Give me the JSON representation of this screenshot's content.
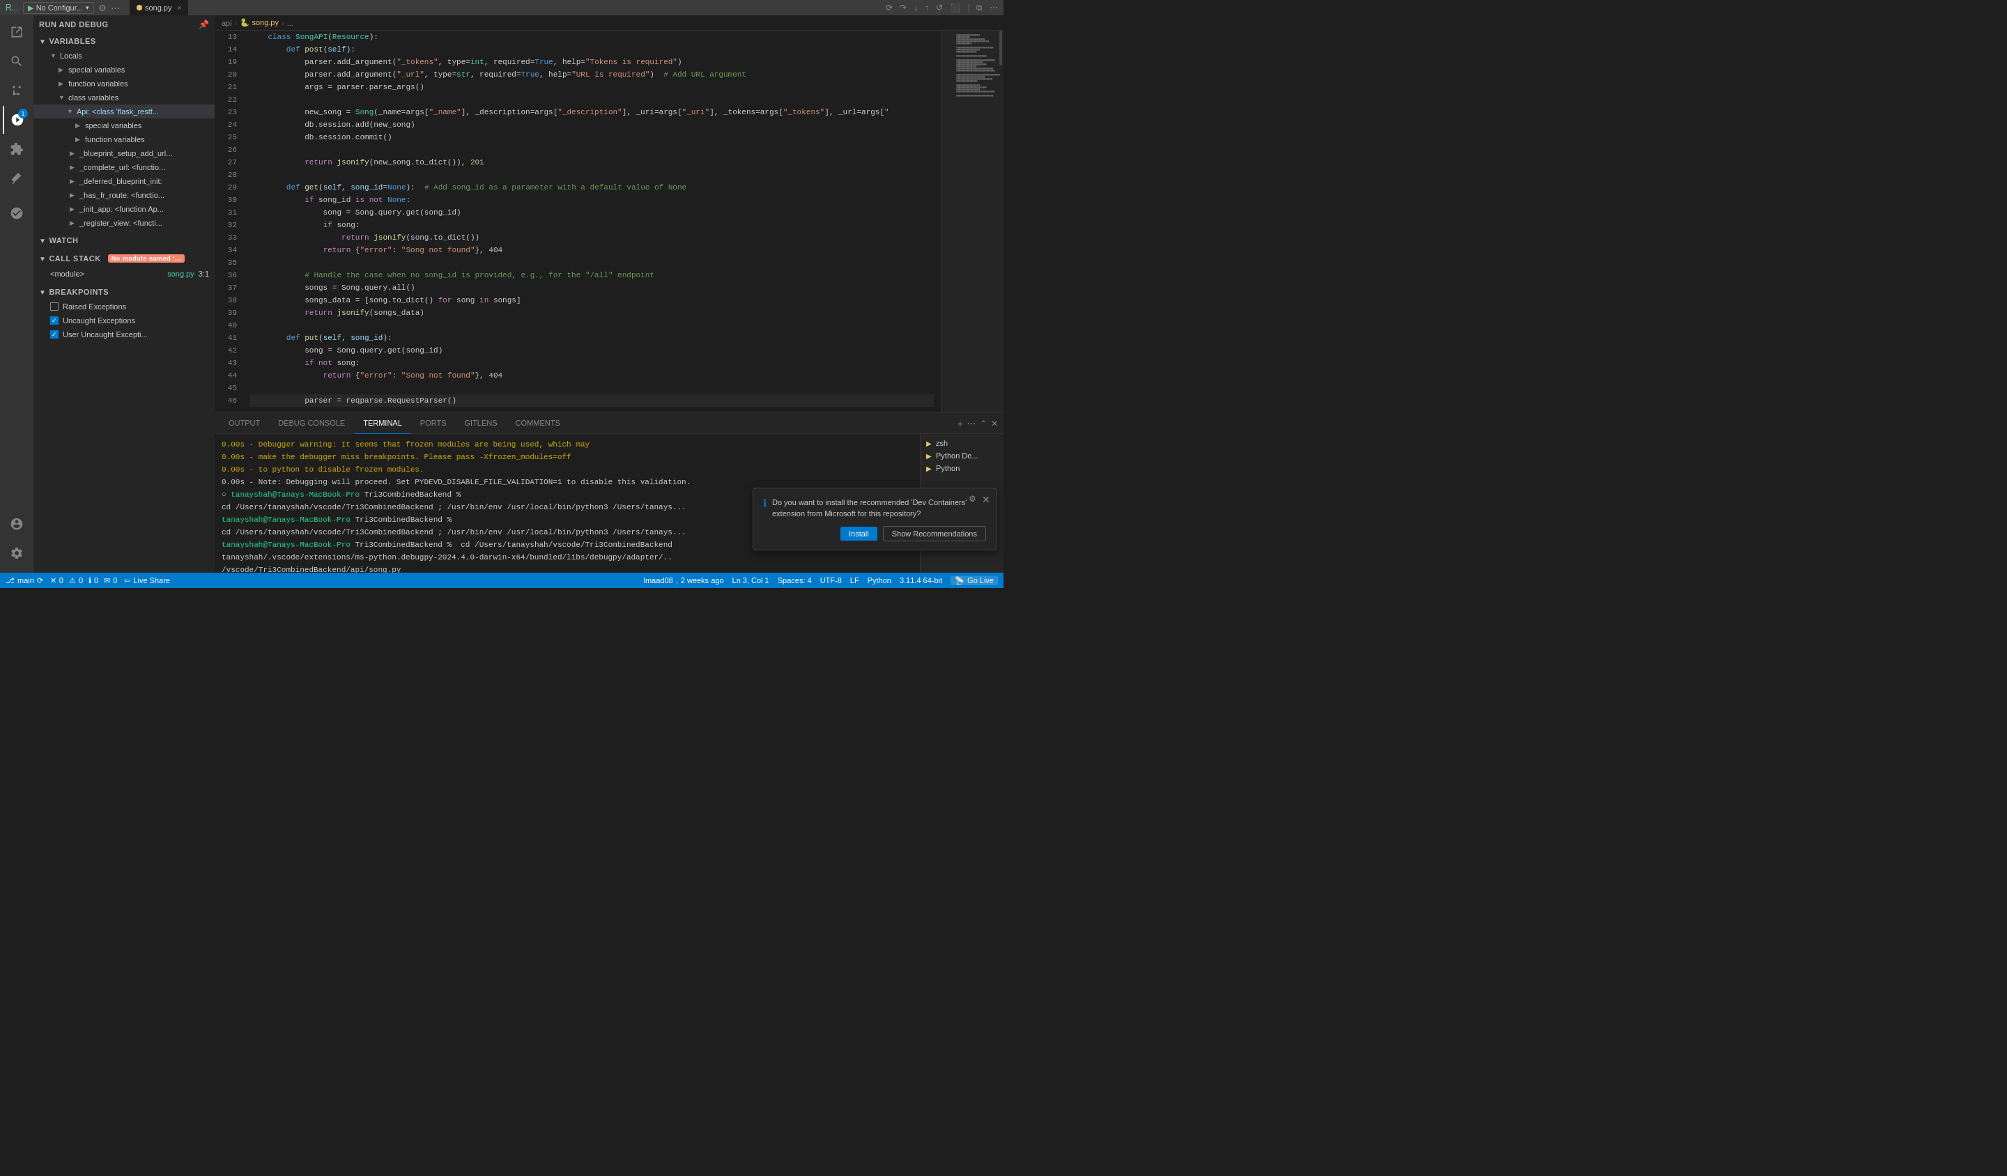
{
  "titlebar": {
    "tab_label": "song.py",
    "tab_close": "×",
    "run_config": "No Configur...",
    "more_icon": "⋯"
  },
  "breadcrumb": {
    "parts": [
      "api",
      ">",
      "song.py",
      ">",
      "..."
    ]
  },
  "sidebar": {
    "title": "RUN AND DEBUG",
    "variables_label": "VARIABLES",
    "locals_label": "Locals",
    "special_vars_label": "special variables",
    "function_vars_label": "function variables",
    "class_vars_label": "class variables",
    "api_class_label": "Api: <class 'flask_restf...",
    "api_special_vars": "special variables",
    "api_function_vars": "function variables",
    "blueprint_label": "_blueprint_setup_add_url...",
    "complete_url_label": "_complete_url: <functio...",
    "deferred_blueprint_label": "_deferred_blueprint_init:",
    "has_fr_route_label": "_has_fr_route: <functio...",
    "init_app_label": "_init_app: <function Ap...",
    "register_view_label": "_register_view: <functi...",
    "watch_label": "WATCH",
    "callstack_label": "CALL STACK",
    "callstack_badge": "No module named '...",
    "module_label": "<module>",
    "file_label": "song.py",
    "file_line": "3:1",
    "breakpoints_label": "BREAKPOINTS",
    "raised_exceptions_label": "Raised Exceptions",
    "uncaught_exceptions_label": "Uncaught Exceptions",
    "user_uncaught_label": "User Uncaught Excepti..."
  },
  "code": {
    "lines": [
      {
        "num": 13,
        "content": "    class SongAPI(Resource):"
      },
      {
        "num": 14,
        "content": "        def post(self):"
      },
      {
        "num": 19,
        "content": "            parser.add_argument(\"_tokens\", type=int, required=True, help=\"Tokens is required\")"
      },
      {
        "num": 20,
        "content": "            parser.add_argument(\"_url\", type=str, required=True, help=\"URL is required\")  # Add URL argument"
      },
      {
        "num": 21,
        "content": "            args = parser.parse_args()"
      },
      {
        "num": 22,
        "content": ""
      },
      {
        "num": 23,
        "content": "            new_song = Song(_name=args[\"_name\"], _description=args[\"_description\"], _uri=args[\"_uri\"], _tokens=args[\"_tokens\"], _url=args[\""
      },
      {
        "num": 24,
        "content": "            db.session.add(new_song)"
      },
      {
        "num": 25,
        "content": "            db.session.commit()"
      },
      {
        "num": 26,
        "content": ""
      },
      {
        "num": 27,
        "content": "            return jsonify(new_song.to_dict()), 201"
      },
      {
        "num": 28,
        "content": ""
      },
      {
        "num": 29,
        "content": "        def get(self, song_id=None):  # Add song_id as a parameter with a default value of None"
      },
      {
        "num": 30,
        "content": "            if song_id is not None:"
      },
      {
        "num": 31,
        "content": "                song = Song.query.get(song_id)"
      },
      {
        "num": 32,
        "content": "                if song:"
      },
      {
        "num": 33,
        "content": "                    return jsonify(song.to_dict())"
      },
      {
        "num": 34,
        "content": "                return {\"error\": \"Song not found\"}, 404"
      },
      {
        "num": 35,
        "content": ""
      },
      {
        "num": 36,
        "content": "            # Handle the case when no song_id is provided, e.g., for the \"/all\" endpoint"
      },
      {
        "num": 37,
        "content": "            songs = Song.query.all()"
      },
      {
        "num": 38,
        "content": "            songs_data = [song.to_dict() for song in songs]"
      },
      {
        "num": 39,
        "content": "            return jsonify(songs_data)"
      },
      {
        "num": 40,
        "content": ""
      },
      {
        "num": 41,
        "content": "        def put(self, song_id):"
      },
      {
        "num": 42,
        "content": "            song = Song.query.get(song_id)"
      },
      {
        "num": 43,
        "content": "            if not song:"
      },
      {
        "num": 44,
        "content": "                return {\"error\": \"Song not found\"}, 404"
      },
      {
        "num": 45,
        "content": ""
      },
      {
        "num": 46,
        "content": "            parser = reqparse.RequestParser()"
      }
    ]
  },
  "panel": {
    "tabs": [
      "OUTPUT",
      "DEBUG CONSOLE",
      "TERMINAL",
      "PORTS",
      "GITLENS",
      "COMMENTS"
    ],
    "active_tab": "TERMINAL",
    "terminal_lines": [
      "0.00s - Debugger warning: It seems that frozen modules are being used, which may",
      "0.00s - make the debugger miss breakpoints. Please pass -Xfrozen_modules=off",
      "0.00s - to python to disable frozen modules.",
      "0.00s - Note: Debugging will proceed. Set PYDEVD_DISABLE_FILE_VALIDATION=1 to disable this validation.",
      "○ tanayshah@Tanays-MacBook-Pro Tri3CombinedBackend %",
      "",
      "cd /Users/tanayshah/vscode/Tri3CombinedBackend ; /usr/bin/env /usr/local/bin/python3 /Users/tanays...",
      "tanayshah@Tanays-MacBook-Pro Tri3CombinedBackend %",
      "cd /Users/tanayshah/vscode/Tri3CombinedBackend ; /usr/bin/env /usr/local/bin/python3 /Users/tanays...",
      "tanayshah@Tanays-MacBook-Pro Tri3CombinedBackend %  cd /Users/tanayshah/vscode/Tri3CombinedBackend",
      "tanayshah/.vscode/extensions/ms-python.debugpy-2024.4.0-darwin-x64/bundled/libs/debugpy/adapter/..",
      "/vscode/Tri3CombinedBackend/api/song.py"
    ],
    "terminal_sessions": [
      {
        "name": "zsh",
        "icon": "▶",
        "color": "#e8c070"
      },
      {
        "name": "Python De...",
        "icon": "▶",
        "color": "#e8c070"
      },
      {
        "name": "Python",
        "icon": "▶",
        "color": "#e8c070"
      }
    ]
  },
  "notification": {
    "text": "Do you want to install the recommended 'Dev Containers' extension from Microsoft for this repository?",
    "install_label": "Install",
    "show_recommendations_label": "Show Recommendations"
  },
  "status_bar": {
    "branch": "main",
    "sync_icon": "⟳",
    "errors": "0",
    "warnings": "0",
    "info": "0",
    "messages": "0",
    "live_share": "Live Share",
    "user": "lmaad08",
    "time_ago": "2 weeks ago",
    "position": "Ln 3, Col 1",
    "spaces": "Spaces: 4",
    "encoding": "UTF-8",
    "eol": "LF",
    "language": "Python",
    "version": "3.11.4 64-bit",
    "go_live": "Go Live"
  }
}
